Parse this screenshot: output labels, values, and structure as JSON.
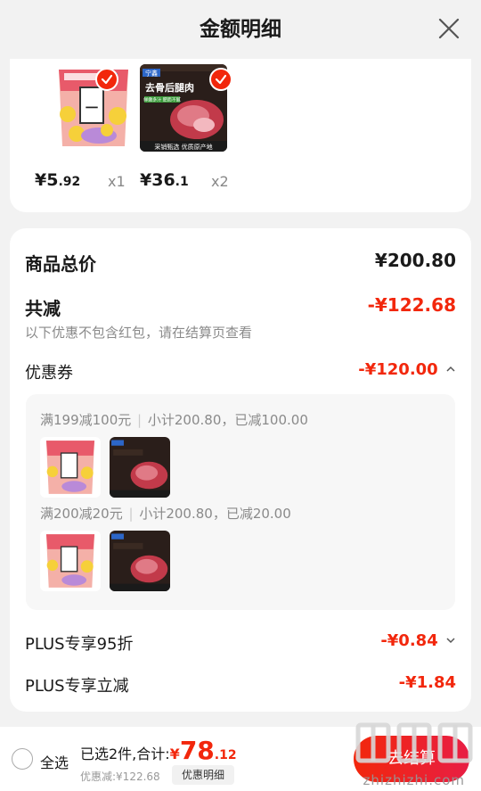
{
  "header": {
    "title": "金额明细"
  },
  "products": [
    {
      "price_major": "¥5",
      "price_minor": ".92",
      "qty": "x1",
      "selected": true
    },
    {
      "price_major": "¥36",
      "price_minor": ".1",
      "qty": "x2",
      "selected": true,
      "img_text": "去骨后腿肉",
      "img_sub": "鲜嫩多汁 肥而不腻",
      "img_banner": "采销甄选 优质原产地",
      "img_logo": "宁鑫"
    }
  ],
  "summary": {
    "total_label": "商品总价",
    "total_value": "¥200.80",
    "reduce_label": "共减",
    "reduce_value": "-¥122.68",
    "note": "以下优惠不包含红包，请在结算页查看",
    "coupon_label": "优惠券",
    "coupon_value": "-¥120.00"
  },
  "coupons": [
    {
      "name": "满199减100元",
      "detail": "小计200.80，已减100.00"
    },
    {
      "name": "满200减20元",
      "detail": "小计200.80，已减20.00"
    }
  ],
  "plus": [
    {
      "label": "PLUS专享95折",
      "value": "-¥0.84"
    },
    {
      "label": "PLUS专享立减",
      "value": "-¥1.84"
    }
  ],
  "bottom": {
    "select_all": "全选",
    "selected_prefix": "已选2件,合计:",
    "total_yuan": "¥",
    "total_major": "78",
    "total_minor": ".12",
    "discount_text": "优惠减:¥122.68",
    "detail_label": "优惠明细",
    "settle_label": "去结算"
  },
  "watermark": {
    "text": "zhizhizhi.com"
  },
  "colors": {
    "accent": "#f2270c",
    "background": "#f2f2f2"
  }
}
